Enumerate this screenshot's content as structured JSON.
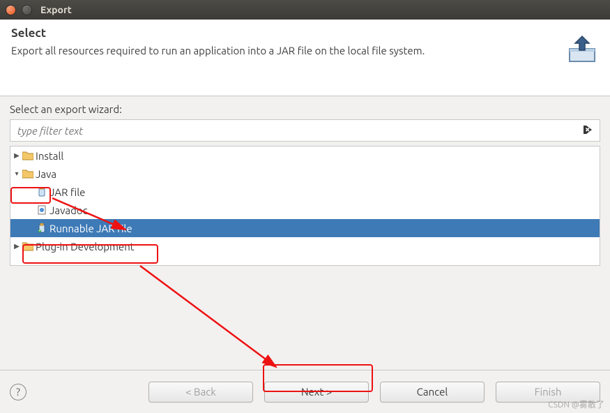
{
  "window": {
    "title": "Export"
  },
  "header": {
    "title": "Select",
    "description": "Export all resources required to run an application into a JAR file on the local file system."
  },
  "body": {
    "label": "Select an export wizard:",
    "filter_placeholder": "type filter text"
  },
  "tree": {
    "items": [
      {
        "label": "Install",
        "kind": "folder",
        "indent": 0,
        "expanded": false
      },
      {
        "label": "Java",
        "kind": "folder",
        "indent": 0,
        "expanded": true
      },
      {
        "label": "JAR file",
        "kind": "jar",
        "indent": 1
      },
      {
        "label": "Javadoc",
        "kind": "doc",
        "indent": 1
      },
      {
        "label": "Runnable JAR file",
        "kind": "jar",
        "indent": 1,
        "selected": true
      },
      {
        "label": "Plug-in Development",
        "kind": "folder",
        "indent": 0,
        "expanded": false
      }
    ]
  },
  "buttons": {
    "back": "< Back",
    "next": "Next >",
    "cancel": "Cancel",
    "finish": "Finish"
  },
  "watermark": "CSDN @雾散了"
}
